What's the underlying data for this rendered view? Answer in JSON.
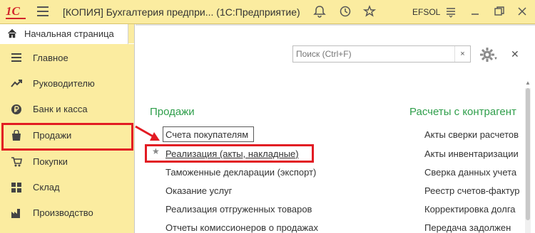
{
  "titlebar": {
    "logo": "1С",
    "title": "[КОПИЯ] Бухгалтерия предпри... (1С:Предприятие)",
    "user": "EFSOL",
    "icons": [
      "bell-icon",
      "history-icon",
      "star-icon",
      "settings-icon",
      "window-restore-icon"
    ]
  },
  "home_tab": {
    "label": "Начальная страница"
  },
  "sidebar": {
    "items": [
      {
        "label": "Главное",
        "icon": "list-icon"
      },
      {
        "label": "Руководителю",
        "icon": "trend-icon"
      },
      {
        "label": "Банк и касса",
        "icon": "ruble-icon"
      },
      {
        "label": "Продажи",
        "icon": "bag-icon"
      },
      {
        "label": "Покупки",
        "icon": "cart-icon"
      },
      {
        "label": "Склад",
        "icon": "grid-icon"
      },
      {
        "label": "Производство",
        "icon": "factory-icon"
      }
    ]
  },
  "search": {
    "placeholder": "Поиск (Ctrl+F)",
    "clear": "×"
  },
  "sections": {
    "sales": {
      "title": "Продажи",
      "links": [
        "Счета покупателям",
        "Реализация (акты, накладные)",
        "Таможенные декларации (экспорт)",
        "Оказание услуг",
        "Реализация отгруженных товаров",
        "Отчеты комиссионеров о продажах"
      ]
    },
    "settlements": {
      "title": "Расчеты с контрагент",
      "links": [
        "Акты сверки расчетов",
        "Акты инвентаризации",
        "Сверка данных учета",
        "Реестр счетов-фактур",
        "Корректировка долга",
        "Передача задолжен"
      ]
    }
  },
  "colors": {
    "accent_red": "#e21b23",
    "section_green": "#2e9e4a",
    "panel_yellow": "#fbeca0"
  }
}
